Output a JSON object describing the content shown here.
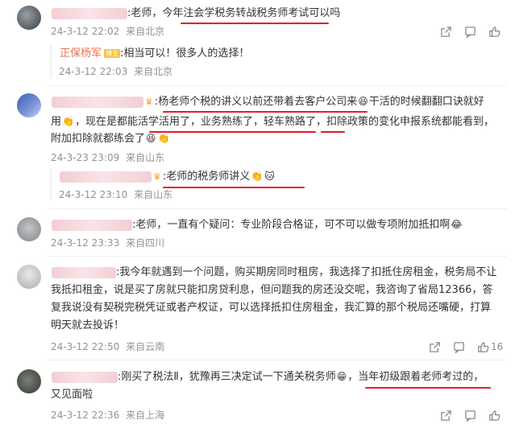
{
  "comments": [
    {
      "text": ":老师，今年注会学税务转战税务师考试可以吗",
      "time": "24-3-12 22:02",
      "location": "来自北京",
      "reply": {
        "author": "正保杨军",
        "badge": "博主",
        "text": ":相当可以！很多人的选择！",
        "time": "24-3-12 22:03",
        "location": "来自北京"
      }
    },
    {
      "line1": ":杨老师个税的讲义以前还带着去客户公司来",
      "line1b": "干活的时候翻翻口诀就好",
      "line2a": "用",
      "line2b": "，现在是都能活学活用了，业务熟练了，轻车熟路了，扣除政策的变化申报系统都能看到，",
      "line3": "附加扣除就都练会了",
      "time": "24-3-23 23:09",
      "location": "来自山东",
      "reply": {
        "text": ":老师的税务师讲义",
        "time": "24-3-12 23:10",
        "location": "来自山东"
      }
    },
    {
      "text": ":老师，一直有个疑问：专业阶段合格证，可不可以做专项附加抵扣啊",
      "time": "24-3-12 23:33",
      "location": "来自四川"
    },
    {
      "line1": ":我今年就遇到一个问题，购买期房同时租房，我选择了扣抵住房租金，税务局不让",
      "line2": "我抵扣租金，说是买了房就只能扣房贷利息，但问题我的房还没交呢，我咨询了省局12366，答",
      "line3": "复我说没有契税完税凭证或者产权证，可以选择抵扣住房租金，我汇算的那个税局还嘴硬，打算",
      "line4": "明天就去投诉！",
      "time": "24-3-12 22:50",
      "location": "来自云南",
      "likes": "16"
    },
    {
      "line1a": ":刚买了税法Ⅱ，犹豫再三决定试一下通关税务师",
      "line1b": "，当年初级跟着老师考过的，",
      "line2": "又见面啦",
      "time": "24-3-12 22:36",
      "location": "来自上海"
    }
  ],
  "icons": [
    "share-icon",
    "comment-icon",
    "like-icon"
  ],
  "accent_color": "#e8192c",
  "link_color": "#eb7350"
}
